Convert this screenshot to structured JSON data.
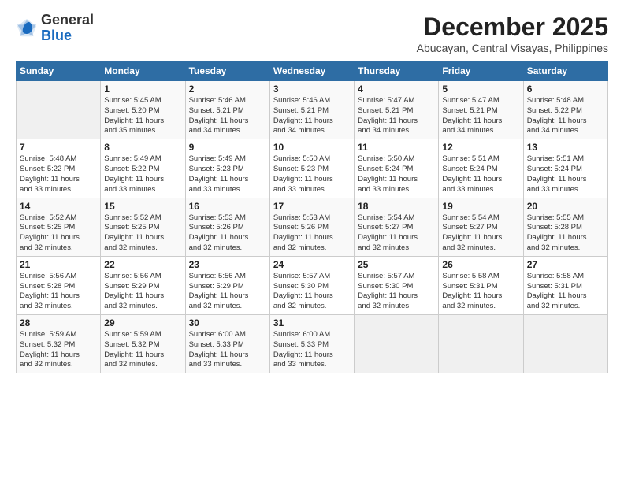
{
  "header": {
    "logo": {
      "general": "General",
      "blue": "Blue"
    },
    "month_year": "December 2025",
    "location": "Abucayan, Central Visayas, Philippines"
  },
  "days_of_week": [
    "Sunday",
    "Monday",
    "Tuesday",
    "Wednesday",
    "Thursday",
    "Friday",
    "Saturday"
  ],
  "weeks": [
    [
      {
        "day": "",
        "info": ""
      },
      {
        "day": "1",
        "info": "Sunrise: 5:45 AM\nSunset: 5:20 PM\nDaylight: 11 hours\nand 35 minutes."
      },
      {
        "day": "2",
        "info": "Sunrise: 5:46 AM\nSunset: 5:21 PM\nDaylight: 11 hours\nand 34 minutes."
      },
      {
        "day": "3",
        "info": "Sunrise: 5:46 AM\nSunset: 5:21 PM\nDaylight: 11 hours\nand 34 minutes."
      },
      {
        "day": "4",
        "info": "Sunrise: 5:47 AM\nSunset: 5:21 PM\nDaylight: 11 hours\nand 34 minutes."
      },
      {
        "day": "5",
        "info": "Sunrise: 5:47 AM\nSunset: 5:21 PM\nDaylight: 11 hours\nand 34 minutes."
      },
      {
        "day": "6",
        "info": "Sunrise: 5:48 AM\nSunset: 5:22 PM\nDaylight: 11 hours\nand 34 minutes."
      }
    ],
    [
      {
        "day": "7",
        "info": "Sunrise: 5:48 AM\nSunset: 5:22 PM\nDaylight: 11 hours\nand 33 minutes."
      },
      {
        "day": "8",
        "info": "Sunrise: 5:49 AM\nSunset: 5:22 PM\nDaylight: 11 hours\nand 33 minutes."
      },
      {
        "day": "9",
        "info": "Sunrise: 5:49 AM\nSunset: 5:23 PM\nDaylight: 11 hours\nand 33 minutes."
      },
      {
        "day": "10",
        "info": "Sunrise: 5:50 AM\nSunset: 5:23 PM\nDaylight: 11 hours\nand 33 minutes."
      },
      {
        "day": "11",
        "info": "Sunrise: 5:50 AM\nSunset: 5:24 PM\nDaylight: 11 hours\nand 33 minutes."
      },
      {
        "day": "12",
        "info": "Sunrise: 5:51 AM\nSunset: 5:24 PM\nDaylight: 11 hours\nand 33 minutes."
      },
      {
        "day": "13",
        "info": "Sunrise: 5:51 AM\nSunset: 5:24 PM\nDaylight: 11 hours\nand 33 minutes."
      }
    ],
    [
      {
        "day": "14",
        "info": "Sunrise: 5:52 AM\nSunset: 5:25 PM\nDaylight: 11 hours\nand 32 minutes."
      },
      {
        "day": "15",
        "info": "Sunrise: 5:52 AM\nSunset: 5:25 PM\nDaylight: 11 hours\nand 32 minutes."
      },
      {
        "day": "16",
        "info": "Sunrise: 5:53 AM\nSunset: 5:26 PM\nDaylight: 11 hours\nand 32 minutes."
      },
      {
        "day": "17",
        "info": "Sunrise: 5:53 AM\nSunset: 5:26 PM\nDaylight: 11 hours\nand 32 minutes."
      },
      {
        "day": "18",
        "info": "Sunrise: 5:54 AM\nSunset: 5:27 PM\nDaylight: 11 hours\nand 32 minutes."
      },
      {
        "day": "19",
        "info": "Sunrise: 5:54 AM\nSunset: 5:27 PM\nDaylight: 11 hours\nand 32 minutes."
      },
      {
        "day": "20",
        "info": "Sunrise: 5:55 AM\nSunset: 5:28 PM\nDaylight: 11 hours\nand 32 minutes."
      }
    ],
    [
      {
        "day": "21",
        "info": "Sunrise: 5:56 AM\nSunset: 5:28 PM\nDaylight: 11 hours\nand 32 minutes."
      },
      {
        "day": "22",
        "info": "Sunrise: 5:56 AM\nSunset: 5:29 PM\nDaylight: 11 hours\nand 32 minutes."
      },
      {
        "day": "23",
        "info": "Sunrise: 5:56 AM\nSunset: 5:29 PM\nDaylight: 11 hours\nand 32 minutes."
      },
      {
        "day": "24",
        "info": "Sunrise: 5:57 AM\nSunset: 5:30 PM\nDaylight: 11 hours\nand 32 minutes."
      },
      {
        "day": "25",
        "info": "Sunrise: 5:57 AM\nSunset: 5:30 PM\nDaylight: 11 hours\nand 32 minutes."
      },
      {
        "day": "26",
        "info": "Sunrise: 5:58 AM\nSunset: 5:31 PM\nDaylight: 11 hours\nand 32 minutes."
      },
      {
        "day": "27",
        "info": "Sunrise: 5:58 AM\nSunset: 5:31 PM\nDaylight: 11 hours\nand 32 minutes."
      }
    ],
    [
      {
        "day": "28",
        "info": "Sunrise: 5:59 AM\nSunset: 5:32 PM\nDaylight: 11 hours\nand 32 minutes."
      },
      {
        "day": "29",
        "info": "Sunrise: 5:59 AM\nSunset: 5:32 PM\nDaylight: 11 hours\nand 32 minutes."
      },
      {
        "day": "30",
        "info": "Sunrise: 6:00 AM\nSunset: 5:33 PM\nDaylight: 11 hours\nand 33 minutes."
      },
      {
        "day": "31",
        "info": "Sunrise: 6:00 AM\nSunset: 5:33 PM\nDaylight: 11 hours\nand 33 minutes."
      },
      {
        "day": "",
        "info": ""
      },
      {
        "day": "",
        "info": ""
      },
      {
        "day": "",
        "info": ""
      }
    ]
  ]
}
